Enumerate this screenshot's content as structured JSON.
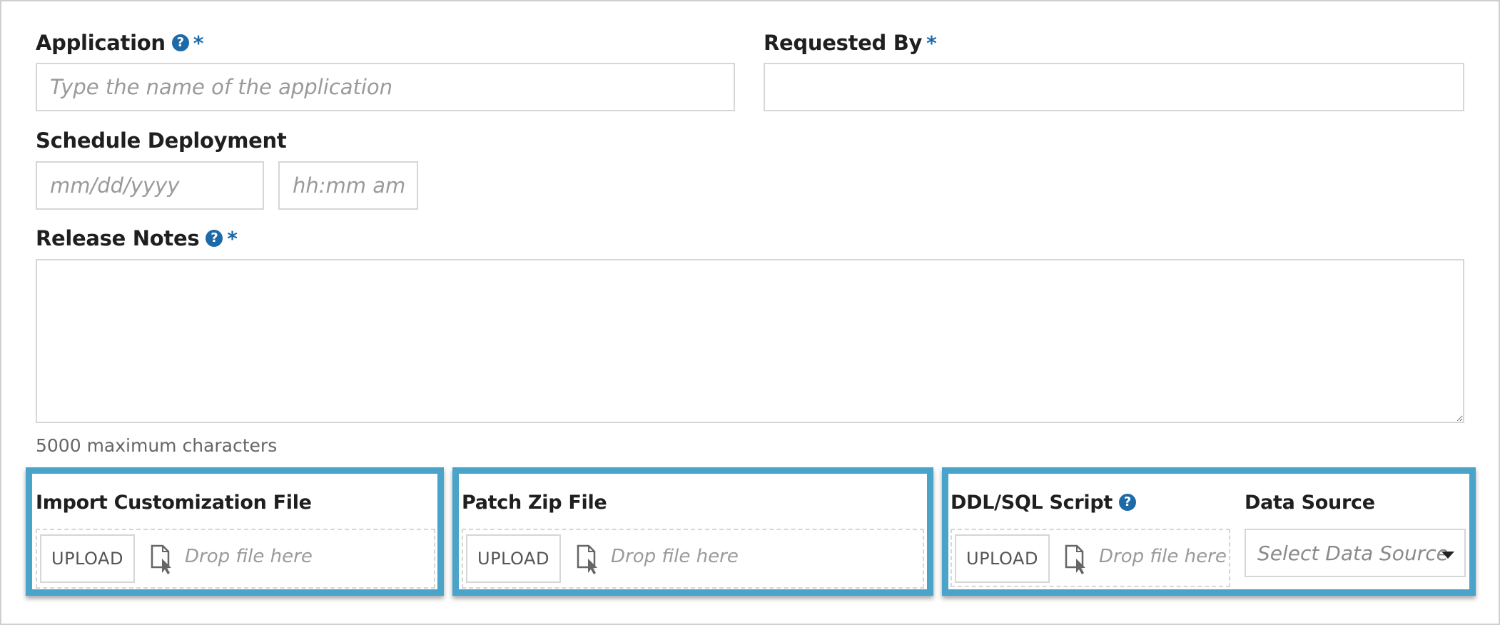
{
  "form": {
    "application": {
      "label": "Application",
      "help_icon": "question-circle-icon",
      "required_mark": "*",
      "placeholder": "Type the name of the application",
      "value": ""
    },
    "requested_by": {
      "label": "Requested By",
      "required_mark": "*",
      "value": ""
    },
    "schedule_deployment": {
      "label": "Schedule Deployment",
      "date_placeholder": "mm/dd/yyyy",
      "time_placeholder": "hh:mm am"
    },
    "release_notes": {
      "label": "Release Notes",
      "help_icon": "question-circle-icon",
      "required_mark": "*",
      "value": "",
      "hint": "5000 maximum characters"
    }
  },
  "uploads": {
    "import_customization": {
      "label": "Import Customization File",
      "button": "UPLOAD",
      "drop_text": "Drop file here",
      "icon": "file-drop-icon"
    },
    "patch_zip": {
      "label": "Patch Zip File",
      "button": "UPLOAD",
      "drop_text": "Drop file here",
      "icon": "file-drop-icon"
    },
    "ddl_sql": {
      "label": "DDL/SQL Script",
      "help_icon": "question-circle-icon",
      "button": "UPLOAD",
      "drop_text": "Drop file here",
      "icon": "file-drop-icon"
    },
    "data_source": {
      "label": "Data Source",
      "placeholder": "Select Data Source",
      "icon": "caret-down-icon"
    }
  },
  "colors": {
    "accent": "#1c6aa8",
    "panel_border": "#4aa3c8"
  }
}
